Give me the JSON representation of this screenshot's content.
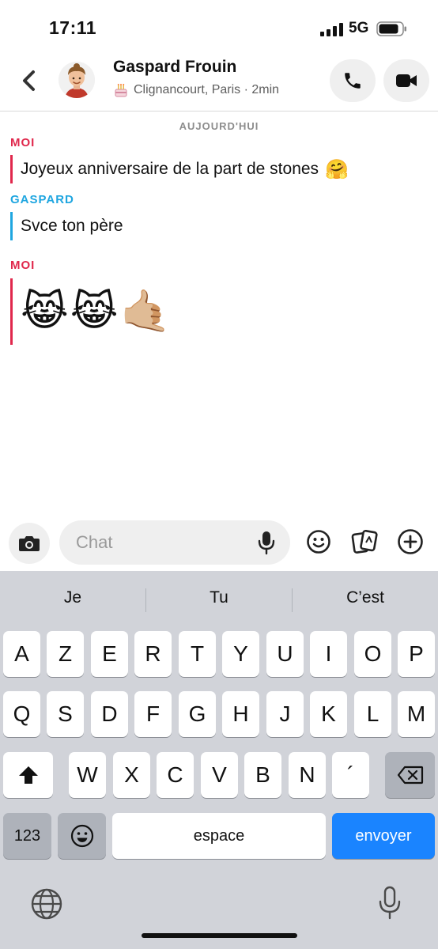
{
  "status_bar": {
    "time": "17:11",
    "network": "5G"
  },
  "header": {
    "name": "Gaspard Frouin",
    "status": "Clignancourt, Paris · 2min"
  },
  "chat": {
    "date_separator": "AUJOURD'HUI",
    "messages": [
      {
        "sender": "MOI",
        "text": "Joyeux anniversaire de la part de stones",
        "emoji": "🤗"
      },
      {
        "sender": "GASPARD",
        "text": "Svce ton père"
      },
      {
        "sender": "MOI",
        "emoji": "😹😹🤙🏼"
      }
    ]
  },
  "input": {
    "placeholder": "Chat"
  },
  "keyboard": {
    "suggestions": [
      "Je",
      "Tu",
      "C’est"
    ],
    "row1": [
      "A",
      "Z",
      "E",
      "R",
      "T",
      "Y",
      "U",
      "I",
      "O",
      "P"
    ],
    "row2": [
      "Q",
      "S",
      "D",
      "F",
      "G",
      "H",
      "J",
      "K",
      "L",
      "M"
    ],
    "row3": [
      "W",
      "X",
      "C",
      "V",
      "B",
      "N",
      "´"
    ],
    "numbers_key": "123",
    "space_key": "espace",
    "send_key": "envoyer"
  },
  "colors": {
    "me": "#e0284c",
    "friend": "#1fa6e0",
    "send_key": "#1a84ff"
  },
  "icons": [
    "back-chevron-icon",
    "avatar",
    "cake-icon",
    "phone-icon",
    "video-camera-icon",
    "camera-icon",
    "microphone-icon",
    "smiley-icon",
    "stickers-icon",
    "plus-circle-icon",
    "shift-icon",
    "backspace-icon",
    "emoji-key-icon",
    "globe-icon"
  ]
}
